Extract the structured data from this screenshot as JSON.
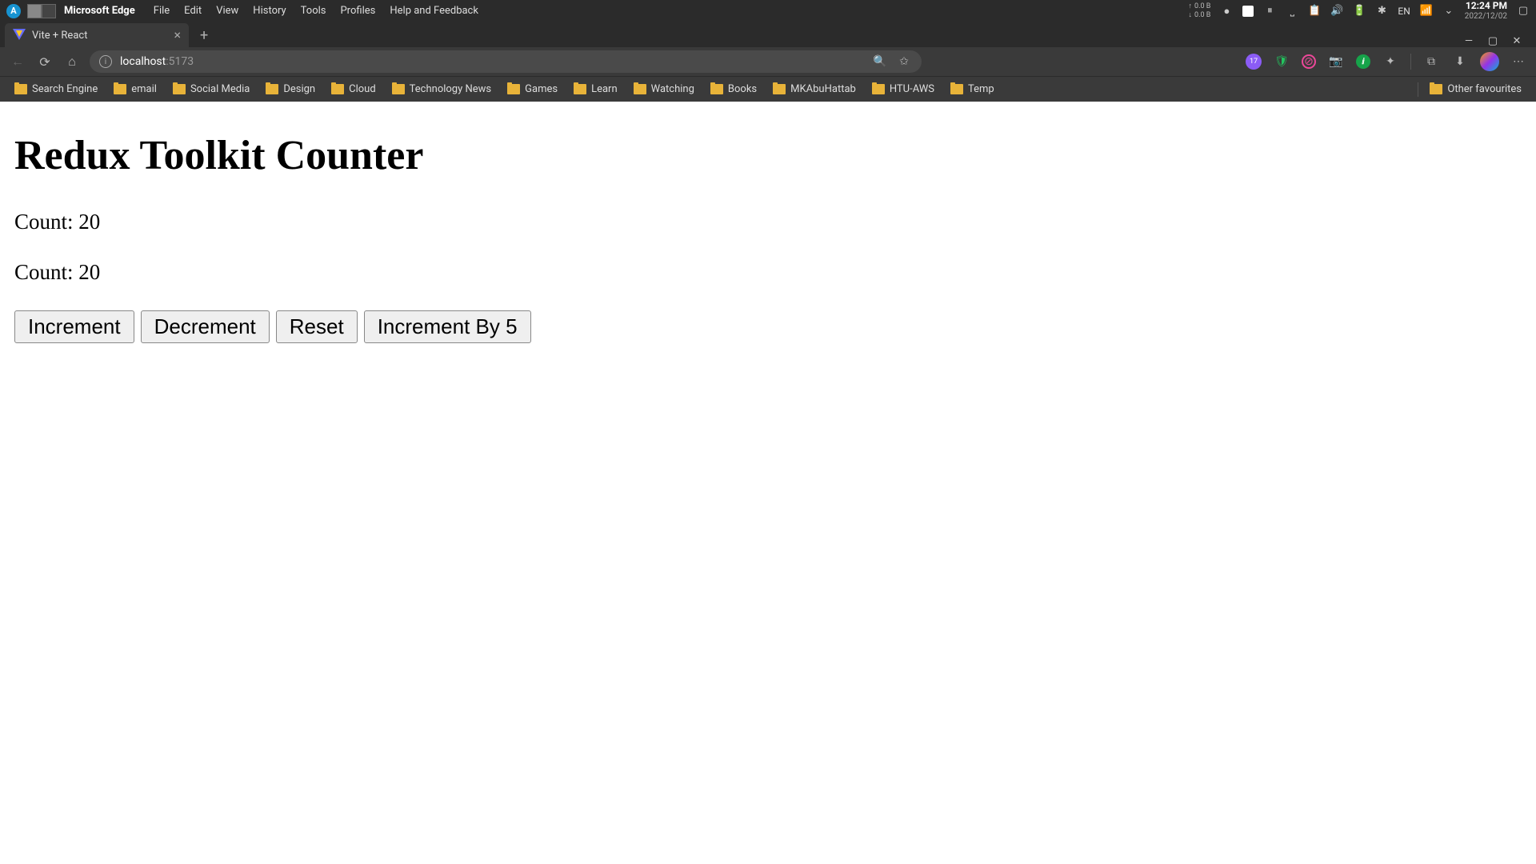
{
  "system": {
    "app_name": "Microsoft Edge",
    "menu": [
      "File",
      "Edit",
      "View",
      "History",
      "Tools",
      "Profiles",
      "Help and Feedback"
    ],
    "net_up": "0.0 B",
    "net_down": "0.0 B",
    "lang": "EN",
    "time": "12:24 PM",
    "date": "2022/12/02"
  },
  "browser": {
    "tab": {
      "title": "Vite + React"
    },
    "url": {
      "host": "localhost",
      "port": ":5173"
    },
    "ext_badge": "17",
    "bookmarks": [
      "Search Engine",
      "email",
      "Social Media",
      "Design",
      "Cloud",
      "Technology News",
      "Games",
      "Learn",
      "Watching",
      "Books",
      "MKAbuHattab",
      "HTU-AWS",
      "Temp"
    ],
    "other_bookmarks": "Other favourites"
  },
  "page": {
    "heading": "Redux Toolkit Counter",
    "count1_label": "Count: ",
    "count1_value": "20",
    "count2_label": "Count: ",
    "count2_value": "20",
    "buttons": {
      "increment": "Increment",
      "decrement": "Decrement",
      "reset": "Reset",
      "increment_by_5": "Increment By 5"
    }
  }
}
